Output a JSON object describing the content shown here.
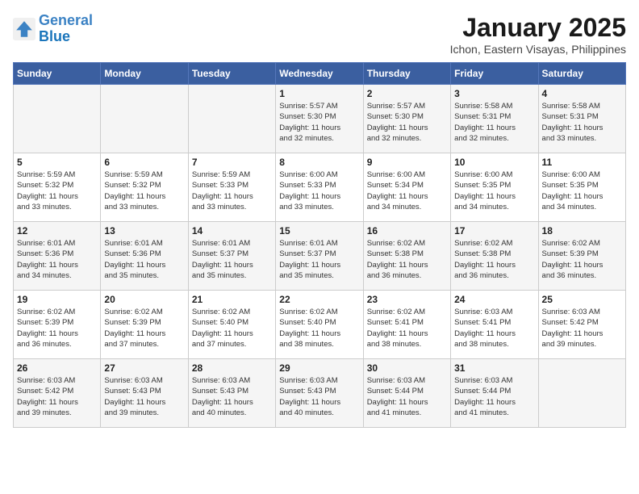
{
  "header": {
    "logo_line1": "General",
    "logo_line2": "Blue",
    "title": "January 2025",
    "subtitle": "Ichon, Eastern Visayas, Philippines"
  },
  "days_of_week": [
    "Sunday",
    "Monday",
    "Tuesday",
    "Wednesday",
    "Thursday",
    "Friday",
    "Saturday"
  ],
  "weeks": [
    [
      {
        "day": "",
        "info": ""
      },
      {
        "day": "",
        "info": ""
      },
      {
        "day": "",
        "info": ""
      },
      {
        "day": "1",
        "info": "Sunrise: 5:57 AM\nSunset: 5:30 PM\nDaylight: 11 hours\nand 32 minutes."
      },
      {
        "day": "2",
        "info": "Sunrise: 5:57 AM\nSunset: 5:30 PM\nDaylight: 11 hours\nand 32 minutes."
      },
      {
        "day": "3",
        "info": "Sunrise: 5:58 AM\nSunset: 5:31 PM\nDaylight: 11 hours\nand 32 minutes."
      },
      {
        "day": "4",
        "info": "Sunrise: 5:58 AM\nSunset: 5:31 PM\nDaylight: 11 hours\nand 33 minutes."
      }
    ],
    [
      {
        "day": "5",
        "info": "Sunrise: 5:59 AM\nSunset: 5:32 PM\nDaylight: 11 hours\nand 33 minutes."
      },
      {
        "day": "6",
        "info": "Sunrise: 5:59 AM\nSunset: 5:32 PM\nDaylight: 11 hours\nand 33 minutes."
      },
      {
        "day": "7",
        "info": "Sunrise: 5:59 AM\nSunset: 5:33 PM\nDaylight: 11 hours\nand 33 minutes."
      },
      {
        "day": "8",
        "info": "Sunrise: 6:00 AM\nSunset: 5:33 PM\nDaylight: 11 hours\nand 33 minutes."
      },
      {
        "day": "9",
        "info": "Sunrise: 6:00 AM\nSunset: 5:34 PM\nDaylight: 11 hours\nand 34 minutes."
      },
      {
        "day": "10",
        "info": "Sunrise: 6:00 AM\nSunset: 5:35 PM\nDaylight: 11 hours\nand 34 minutes."
      },
      {
        "day": "11",
        "info": "Sunrise: 6:00 AM\nSunset: 5:35 PM\nDaylight: 11 hours\nand 34 minutes."
      }
    ],
    [
      {
        "day": "12",
        "info": "Sunrise: 6:01 AM\nSunset: 5:36 PM\nDaylight: 11 hours\nand 34 minutes."
      },
      {
        "day": "13",
        "info": "Sunrise: 6:01 AM\nSunset: 5:36 PM\nDaylight: 11 hours\nand 35 minutes."
      },
      {
        "day": "14",
        "info": "Sunrise: 6:01 AM\nSunset: 5:37 PM\nDaylight: 11 hours\nand 35 minutes."
      },
      {
        "day": "15",
        "info": "Sunrise: 6:01 AM\nSunset: 5:37 PM\nDaylight: 11 hours\nand 35 minutes."
      },
      {
        "day": "16",
        "info": "Sunrise: 6:02 AM\nSunset: 5:38 PM\nDaylight: 11 hours\nand 36 minutes."
      },
      {
        "day": "17",
        "info": "Sunrise: 6:02 AM\nSunset: 5:38 PM\nDaylight: 11 hours\nand 36 minutes."
      },
      {
        "day": "18",
        "info": "Sunrise: 6:02 AM\nSunset: 5:39 PM\nDaylight: 11 hours\nand 36 minutes."
      }
    ],
    [
      {
        "day": "19",
        "info": "Sunrise: 6:02 AM\nSunset: 5:39 PM\nDaylight: 11 hours\nand 36 minutes."
      },
      {
        "day": "20",
        "info": "Sunrise: 6:02 AM\nSunset: 5:39 PM\nDaylight: 11 hours\nand 37 minutes."
      },
      {
        "day": "21",
        "info": "Sunrise: 6:02 AM\nSunset: 5:40 PM\nDaylight: 11 hours\nand 37 minutes."
      },
      {
        "day": "22",
        "info": "Sunrise: 6:02 AM\nSunset: 5:40 PM\nDaylight: 11 hours\nand 38 minutes."
      },
      {
        "day": "23",
        "info": "Sunrise: 6:02 AM\nSunset: 5:41 PM\nDaylight: 11 hours\nand 38 minutes."
      },
      {
        "day": "24",
        "info": "Sunrise: 6:03 AM\nSunset: 5:41 PM\nDaylight: 11 hours\nand 38 minutes."
      },
      {
        "day": "25",
        "info": "Sunrise: 6:03 AM\nSunset: 5:42 PM\nDaylight: 11 hours\nand 39 minutes."
      }
    ],
    [
      {
        "day": "26",
        "info": "Sunrise: 6:03 AM\nSunset: 5:42 PM\nDaylight: 11 hours\nand 39 minutes."
      },
      {
        "day": "27",
        "info": "Sunrise: 6:03 AM\nSunset: 5:43 PM\nDaylight: 11 hours\nand 39 minutes."
      },
      {
        "day": "28",
        "info": "Sunrise: 6:03 AM\nSunset: 5:43 PM\nDaylight: 11 hours\nand 40 minutes."
      },
      {
        "day": "29",
        "info": "Sunrise: 6:03 AM\nSunset: 5:43 PM\nDaylight: 11 hours\nand 40 minutes."
      },
      {
        "day": "30",
        "info": "Sunrise: 6:03 AM\nSunset: 5:44 PM\nDaylight: 11 hours\nand 41 minutes."
      },
      {
        "day": "31",
        "info": "Sunrise: 6:03 AM\nSunset: 5:44 PM\nDaylight: 11 hours\nand 41 minutes."
      },
      {
        "day": "",
        "info": ""
      }
    ]
  ]
}
